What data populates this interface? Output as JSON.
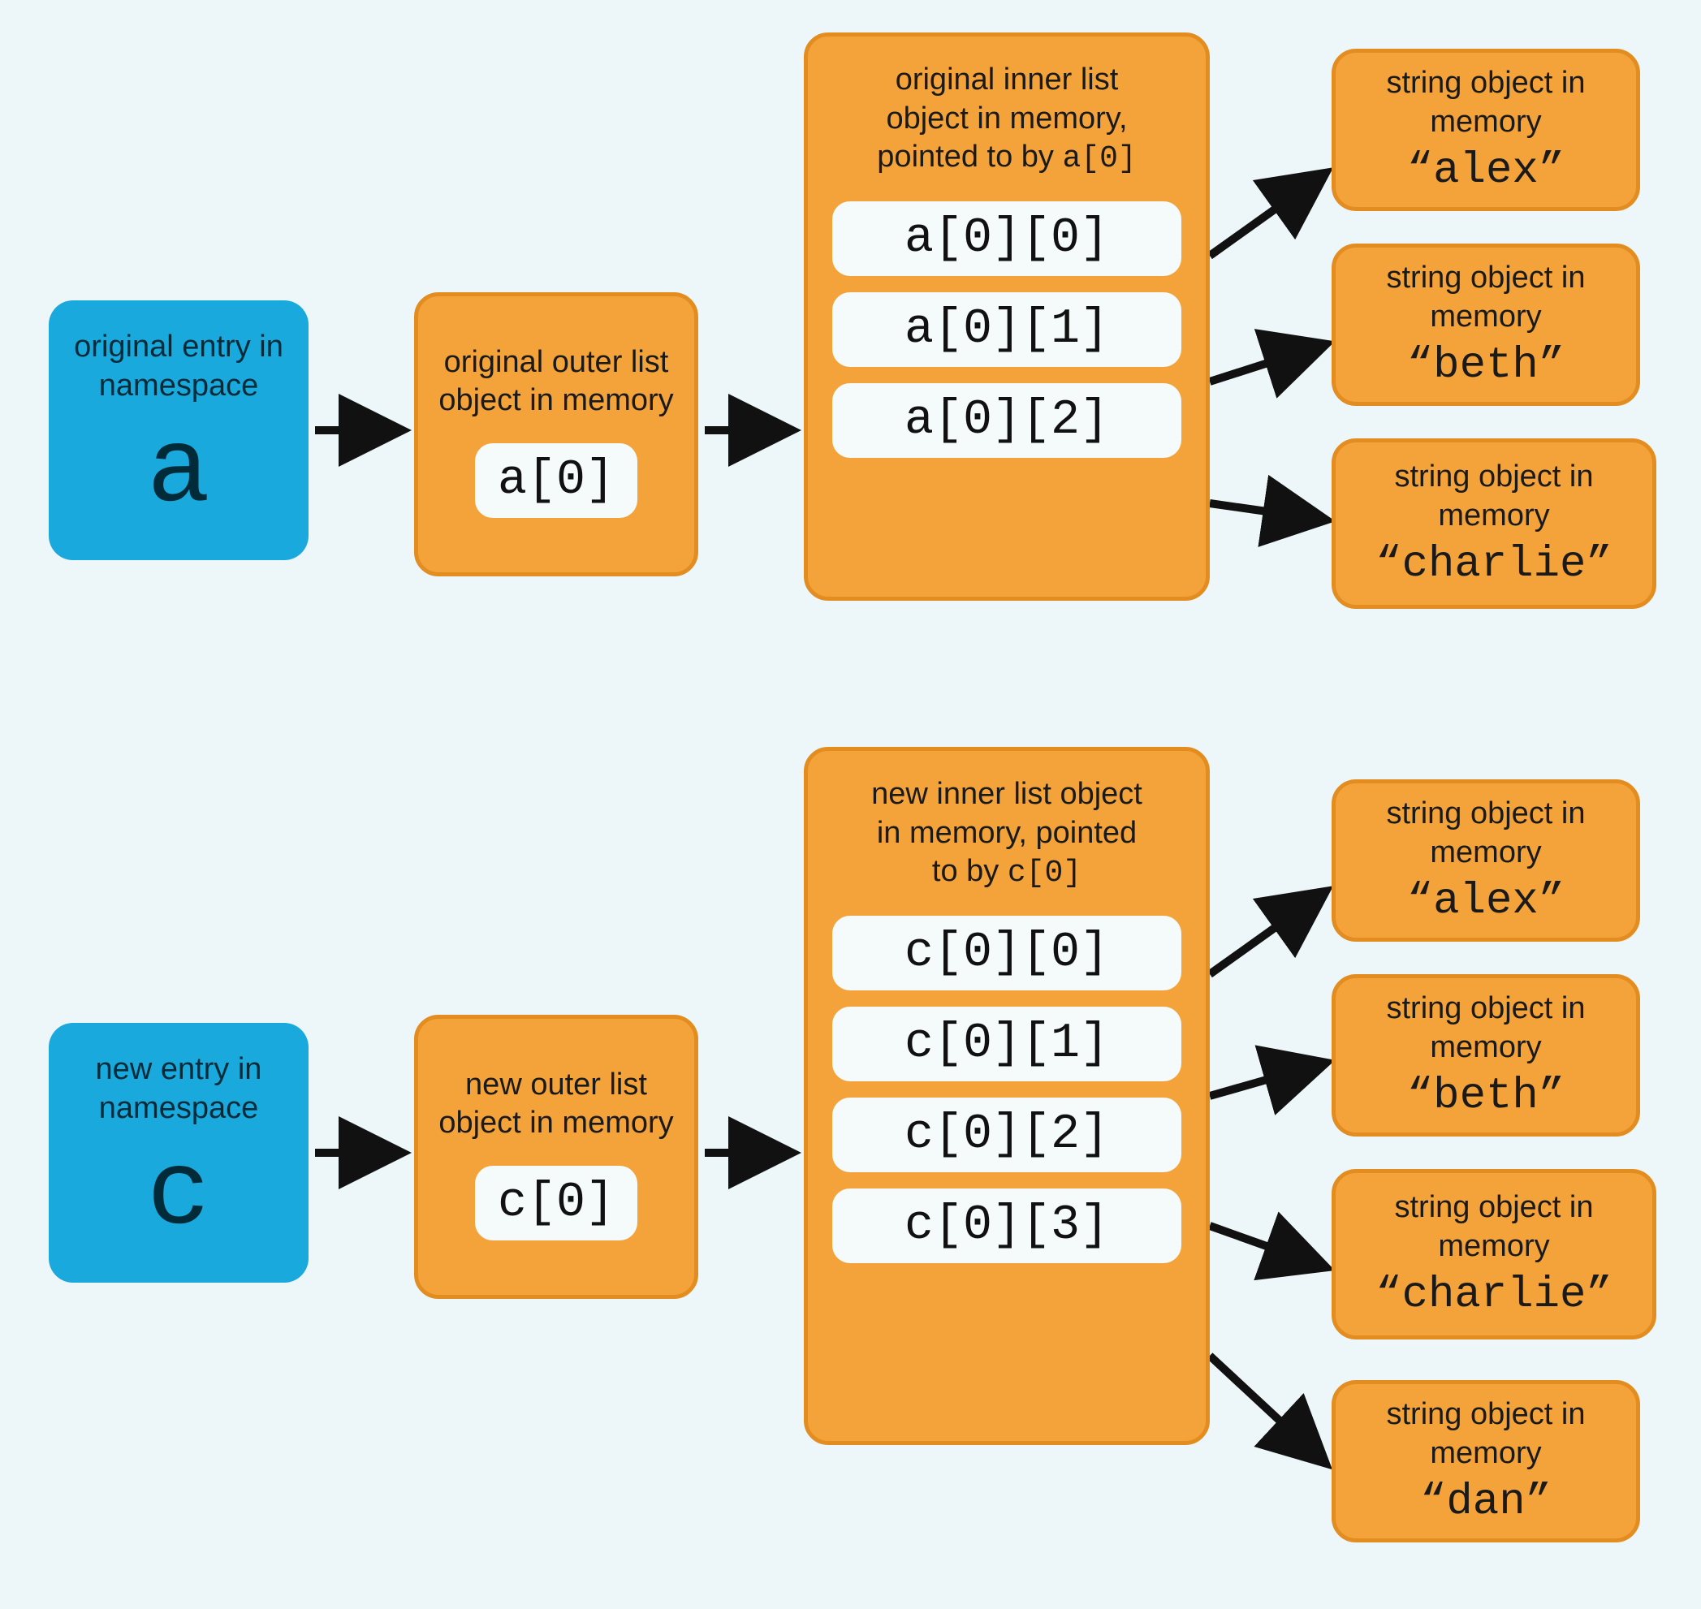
{
  "a_namespace": {
    "label": "original entry in namespace",
    "var": "a"
  },
  "a_outer": {
    "label": "original outer list object in memory",
    "item": "a[0]"
  },
  "a_inner": {
    "label_l1": "original inner list",
    "label_l2": "object in memory,",
    "label_l3_pre": "pointed to by ",
    "label_l3_code": "a[0]",
    "items": [
      "a[0][0]",
      "a[0][1]",
      "a[0][2]"
    ]
  },
  "c_namespace": {
    "label": "new entry in namespace",
    "var": "c"
  },
  "c_outer": {
    "label": "new outer list object in memory",
    "item": "c[0]"
  },
  "c_inner": {
    "label_l1": "new inner list object",
    "label_l2": "in memory, pointed",
    "label_l3_pre": "to by ",
    "label_l3_code": "c[0]",
    "items": [
      "c[0][0]",
      "c[0][1]",
      "c[0][2]",
      "c[0][3]"
    ]
  },
  "strings": {
    "label": "string object in memory",
    "a0": "“alex”",
    "a1": "“beth”",
    "a2": "“charlie”",
    "c0": "“alex”",
    "c1": "“beth”",
    "c2": "“charlie”",
    "c3": "“dan”"
  }
}
